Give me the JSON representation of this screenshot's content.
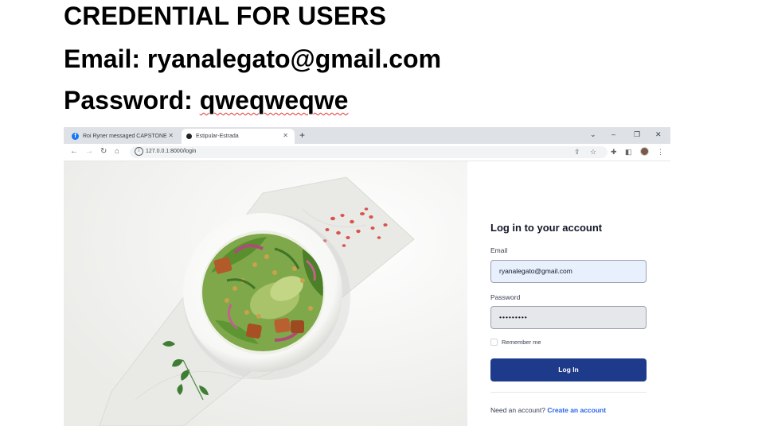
{
  "doc": {
    "heading": "CREDENTIAL FOR USERS",
    "email_label": "Email:",
    "email_value": "ryanalegato@gmail.com",
    "password_label": "Password:",
    "password_value": "qweqweqwe"
  },
  "browser": {
    "tabs": [
      {
        "title": "Roi Ryner messaged CAPSTONE",
        "icon": "facebook-icon"
      },
      {
        "title": "Estipular-Estrada",
        "icon": "site-dot-icon"
      }
    ],
    "url": "127.0.0.1:8000/login"
  },
  "login": {
    "title": "Log in to your account",
    "email_label": "Email",
    "email_value": "ryanalegato@gmail.com",
    "password_label": "Password",
    "password_mask": "•••••••••",
    "remember_label": "Remember me",
    "button_label": "Log In",
    "signup_prompt": "Need an account?",
    "signup_link": "Create an account"
  },
  "colors": {
    "primary_button": "#1e3a8a",
    "link": "#2563eb",
    "email_input_bg": "#e8f0fe"
  }
}
